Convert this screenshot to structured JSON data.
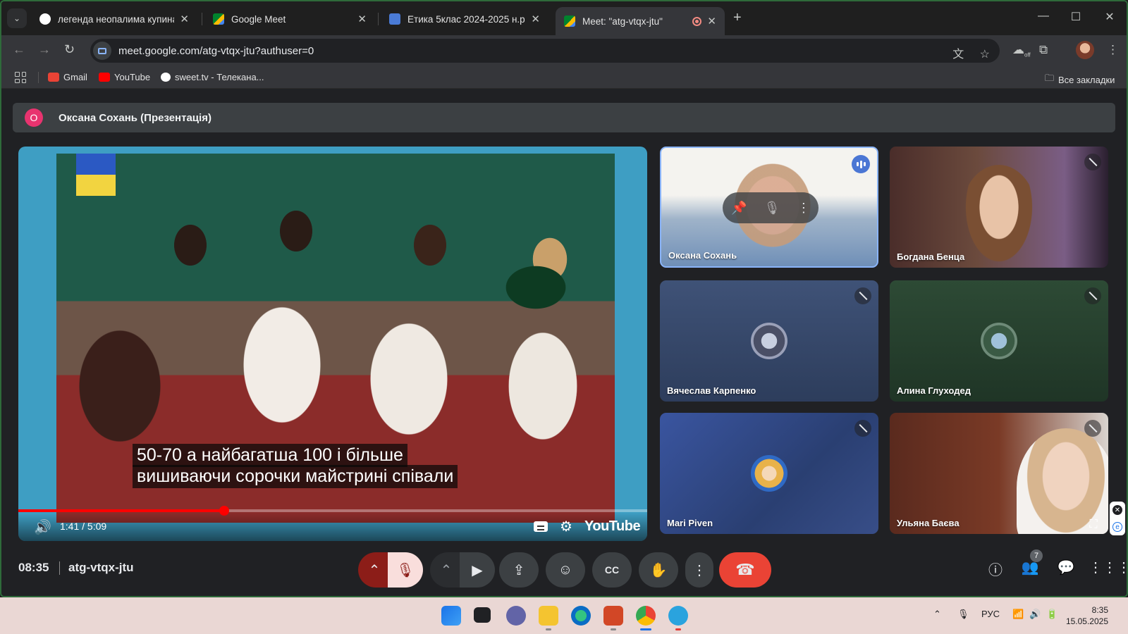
{
  "browser": {
    "tabs": [
      {
        "title": "легенда неопалима купина - П",
        "favicon_color": "#4285f4"
      },
      {
        "title": "Google Meet",
        "favicon_color": "#00832d"
      },
      {
        "title": "Етика 5клас 2024-2025 н.р.",
        "favicon_color": "#4a7bd6"
      },
      {
        "title": "Meet: \"atg-vtqx-jtu\"",
        "favicon_color": "#00832d"
      }
    ],
    "url": "meet.google.com/atg-vtqx-jtu?authuser=0",
    "bookmarks": [
      {
        "label": "Gmail",
        "color": "#ea4335"
      },
      {
        "label": "YouTube",
        "color": "#ff0000"
      },
      {
        "label": "sweet.tv - Телекана...",
        "color": "#ffffff"
      }
    ],
    "all_bookmarks": "Все закладки",
    "extension_badge": "off"
  },
  "meet": {
    "presenter_initial": "О",
    "presenter_title": "Оксана Сохань (Презентація)",
    "video": {
      "subtitle_line1": "50-70 а найбагатша 100 і більше",
      "subtitle_line2": "вишиваючи сорочки майстрині співали",
      "time": "1:41 / 5:09",
      "progress_fraction": 0.327,
      "logo": "YouTube"
    },
    "participants": [
      {
        "name": "Оксана Сохань",
        "state": "speaking"
      },
      {
        "name": "Богдана Бенца",
        "state": "muted"
      },
      {
        "name": "Вячеслав Карпенко",
        "state": "muted"
      },
      {
        "name": "Алина Глуходед",
        "state": "muted"
      },
      {
        "name": "Mari Piven",
        "state": "muted"
      },
      {
        "name": "Ульяна Баєва",
        "state": "muted"
      }
    ],
    "clock": "08:35",
    "meeting_code": "atg-vtqx-jtu",
    "people_count": "7"
  },
  "taskbar": {
    "language": "РУС",
    "time": "8:35",
    "date": "15.05.2025"
  }
}
